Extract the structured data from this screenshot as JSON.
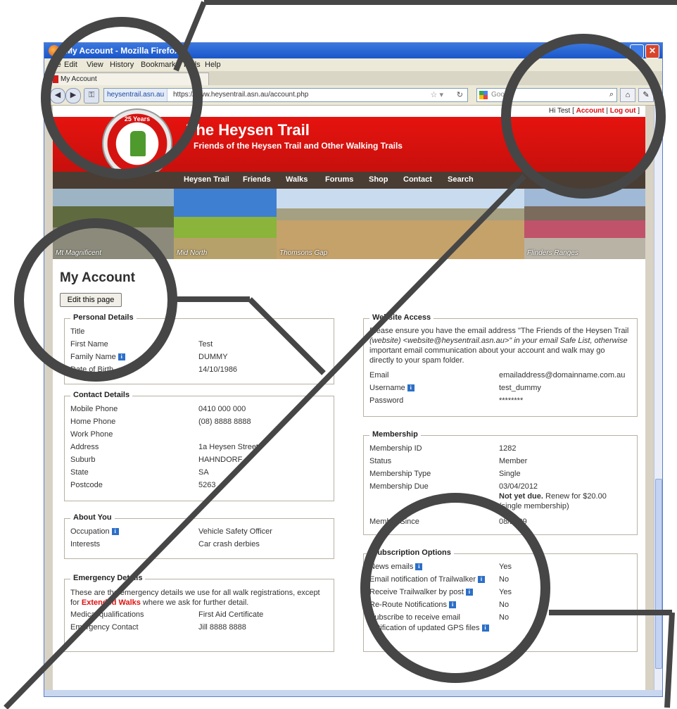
{
  "browser": {
    "title": "My Account - Mozilla Firefox",
    "menu": [
      "File",
      "Edit",
      "View",
      "History",
      "Bookmarks",
      "Tools",
      "Help"
    ],
    "tab_label": "My Account",
    "site_badge": "heysentrail.asn.au",
    "url": "https://www.heysentrail.asn.au/account.php",
    "search_placeholder": "Google"
  },
  "greeting": {
    "prefix": "Hi Test [ ",
    "account_link": "Account",
    "separator": " | ",
    "logout_link": "Log out",
    "suffix": " ]"
  },
  "site": {
    "title": "The Heysen Trail",
    "subtitle": "Friends of the Heysen Trail and Other Walking Trails",
    "logo_text": "25 Years"
  },
  "nav": [
    "Heysen Trail",
    "Friends",
    "Walks",
    "Forums",
    "Shop",
    "Contact",
    "Search"
  ],
  "photos": [
    "Mt Magnificent",
    "Mid North",
    "Thomsons Gap",
    "Flinders Ranges"
  ],
  "page": {
    "heading": "My Account",
    "edit_button": "Edit this page"
  },
  "personal": {
    "legend": "Personal Details",
    "rows": [
      {
        "label": "Title",
        "value": ""
      },
      {
        "label": "First Name",
        "value": "Test"
      },
      {
        "label": "Family Name",
        "value": "DUMMY"
      },
      {
        "label": "Date of Birth",
        "value": "14/10/1986"
      }
    ]
  },
  "contact": {
    "legend": "Contact Details",
    "rows": [
      {
        "label": "Mobile Phone",
        "value": "0410 000 000"
      },
      {
        "label": "Home Phone",
        "value": "(08) 8888 8888"
      },
      {
        "label": "Work Phone",
        "value": ""
      },
      {
        "label": "Address",
        "value": "1a Heysen Street"
      },
      {
        "label": "Suburb",
        "value": "HAHNDORF"
      },
      {
        "label": "State",
        "value": "SA"
      },
      {
        "label": "Postcode",
        "value": "5263"
      }
    ]
  },
  "about": {
    "legend": "About You",
    "rows": [
      {
        "label": "Occupation",
        "value": "Vehicle Safety Officer"
      },
      {
        "label": "Interests",
        "value": "Car crash derbies"
      }
    ]
  },
  "emergency": {
    "legend": "Emergency Details",
    "intro_1": "These are the emergency details we use for all walk registrations, except",
    "intro_2_pre": "for ",
    "intro_2_link": "Extended Walks",
    "intro_2_post": " where we ask for further detail.",
    "rows": [
      {
        "label": "Medical qualifications",
        "value": "First Aid Certificate"
      },
      {
        "label": "Emergency Contact",
        "value": "Jill 8888 8888"
      }
    ]
  },
  "website": {
    "legend": "Website Access",
    "line1": "Please ensure you have the email address \"The Friends of the Heysen Trail",
    "line2": "(website) <website@heysentrail.asn.au>\" in your email Safe List, otherwise",
    "line3": "important email communication about your account and walk may go",
    "line4": "directly to your spam folder.",
    "rows": [
      {
        "label": "Email",
        "value": "emailaddress@domainname.com.au"
      },
      {
        "label": "Username",
        "value": "test_dummy"
      },
      {
        "label": "Password",
        "value": "********"
      }
    ]
  },
  "membership": {
    "legend": "Membership",
    "rows": [
      {
        "label": "Membership ID",
        "value": "1282"
      },
      {
        "label": "Status",
        "value": "Member"
      },
      {
        "label": "Membership Type",
        "value": "Single"
      },
      {
        "label": "Membership Due",
        "value": "03/04/2012"
      }
    ],
    "due_status": "Not yet due.",
    "due_note": " Renew for $20.00",
    "due_note_2": "(single membership)",
    "member_since_label": "Member Since",
    "member_since_value": "08/2009"
  },
  "subscription": {
    "legend": "Subscription Options",
    "rows": [
      {
        "label": "News emails",
        "value": "Yes"
      },
      {
        "label": "Email notification of Trailwalker",
        "value": "No"
      },
      {
        "label": "Receive Trailwalker by post",
        "value": "Yes"
      },
      {
        "label": "Re-Route Notifications",
        "value": "No"
      },
      {
        "label": "Subscribe to receive email",
        "label2": "notification of updated GPS files",
        "value": "No"
      }
    ]
  },
  "colors": {
    "brand_red": "#d51412",
    "nav_brown": "#4a3d33",
    "magnifier_border": "#464646",
    "info_blue": "#2c6fc8"
  }
}
